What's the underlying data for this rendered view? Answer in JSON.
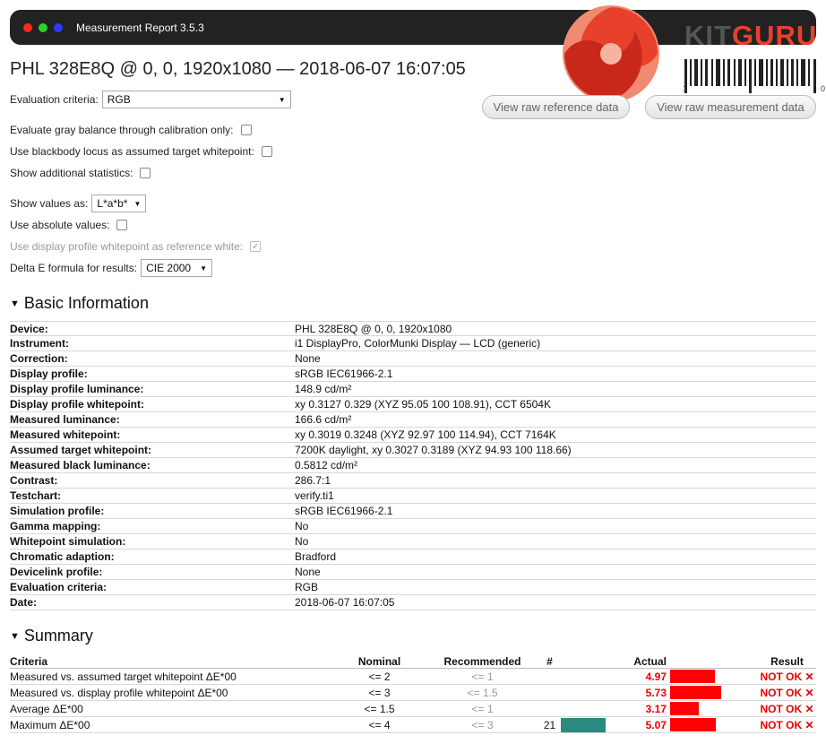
{
  "window": {
    "title": "Measurement Report 3.5.3"
  },
  "branding": {
    "kit": "KIT",
    "guru": "GURU",
    "barcode_left": "1",
    "barcode_right": "0"
  },
  "page_title": "PHL 328E8Q @ 0, 0, 1920x1080 — 2018-06-07 16:07:05",
  "controls": {
    "evaluation_criteria_label": "Evaluation criteria:",
    "evaluation_criteria_value": "RGB",
    "gray_balance_label": "Evaluate gray balance through calibration only:",
    "blackbody_label": "Use blackbody locus as assumed target whitepoint:",
    "additional_stats_label": "Show additional statistics:",
    "show_values_label": "Show values as:",
    "show_values_value": "L*a*b*",
    "absolute_values_label": "Use absolute values:",
    "display_whitepoint_label": "Use display profile whitepoint as reference white:",
    "delta_e_label": "Delta E formula for results:",
    "delta_e_value": "CIE 2000"
  },
  "buttons": {
    "raw_reference": "View raw reference data",
    "raw_measurement": "View raw measurement data"
  },
  "basic_info": {
    "heading": "Basic Information",
    "rows": [
      {
        "key": "Device:",
        "value": "PHL 328E8Q @ 0, 0, 1920x1080"
      },
      {
        "key": "Instrument:",
        "value": "i1 DisplayPro, ColorMunki Display — LCD (generic)"
      },
      {
        "key": "Correction:",
        "value": "None"
      },
      {
        "key": "Display profile:",
        "value": "sRGB IEC61966-2.1"
      },
      {
        "key": "Display profile luminance:",
        "value": "148.9 cd/m²"
      },
      {
        "key": "Display profile whitepoint:",
        "value": "xy 0.3127 0.329 (XYZ 95.05 100 108.91), CCT 6504K"
      },
      {
        "key": "Measured luminance:",
        "value": "166.6 cd/m²"
      },
      {
        "key": "Measured whitepoint:",
        "value": "xy 0.3019 0.3248 (XYZ 92.97 100 114.94), CCT 7164K"
      },
      {
        "key": "Assumed target whitepoint:",
        "value": "7200K daylight, xy 0.3027 0.3189 (XYZ 94.93 100 118.66)"
      },
      {
        "key": "Measured black luminance:",
        "value": "0.5812 cd/m²"
      },
      {
        "key": "Contrast:",
        "value": "286.7:1"
      },
      {
        "key": "Testchart:",
        "value": "verify.ti1"
      },
      {
        "key": "Simulation profile:",
        "value": "sRGB IEC61966-2.1"
      },
      {
        "key": "Gamma mapping:",
        "value": "No"
      },
      {
        "key": "Whitepoint simulation:",
        "value": "No"
      },
      {
        "key": "Chromatic adaption:",
        "value": "Bradford"
      },
      {
        "key": "Devicelink profile:",
        "value": "None"
      },
      {
        "key": "Evaluation criteria:",
        "value": "RGB"
      },
      {
        "key": "Date:",
        "value": "2018-06-07 16:07:05"
      }
    ]
  },
  "summary": {
    "heading": "Summary",
    "headers": {
      "criteria": "Criteria",
      "nominal": "Nominal",
      "recommended": "Recommended",
      "hash": "#",
      "actual": "Actual",
      "result": "Result"
    },
    "rows": [
      {
        "criteria": "Measured vs. assumed target whitepoint ΔE*00",
        "nominal": "<= 2",
        "recommended": "<= 1",
        "hash": "",
        "actual": "4.97",
        "result": "NOT OK ✕",
        "bar_fraction": 0.497
      },
      {
        "criteria": "Measured vs. display profile whitepoint ΔE*00",
        "nominal": "<= 3",
        "recommended": "<= 1.5",
        "hash": "",
        "actual": "5.73",
        "result": "NOT OK ✕",
        "bar_fraction": 0.573
      },
      {
        "criteria": "Average ΔE*00",
        "nominal": "<= 1.5",
        "recommended": "<= 1",
        "hash": "",
        "actual": "3.17",
        "result": "NOT OK ✕",
        "bar_fraction": 0.317
      },
      {
        "criteria": "Maximum ΔE*00",
        "nominal": "<= 4",
        "recommended": "<= 3",
        "hash": "21",
        "actual": "5.07",
        "result": "NOT OK ✕",
        "bar_fraction": 0.507
      }
    ]
  },
  "colors": {
    "fail": "#ff0000",
    "histogram": "#2a8a80"
  }
}
